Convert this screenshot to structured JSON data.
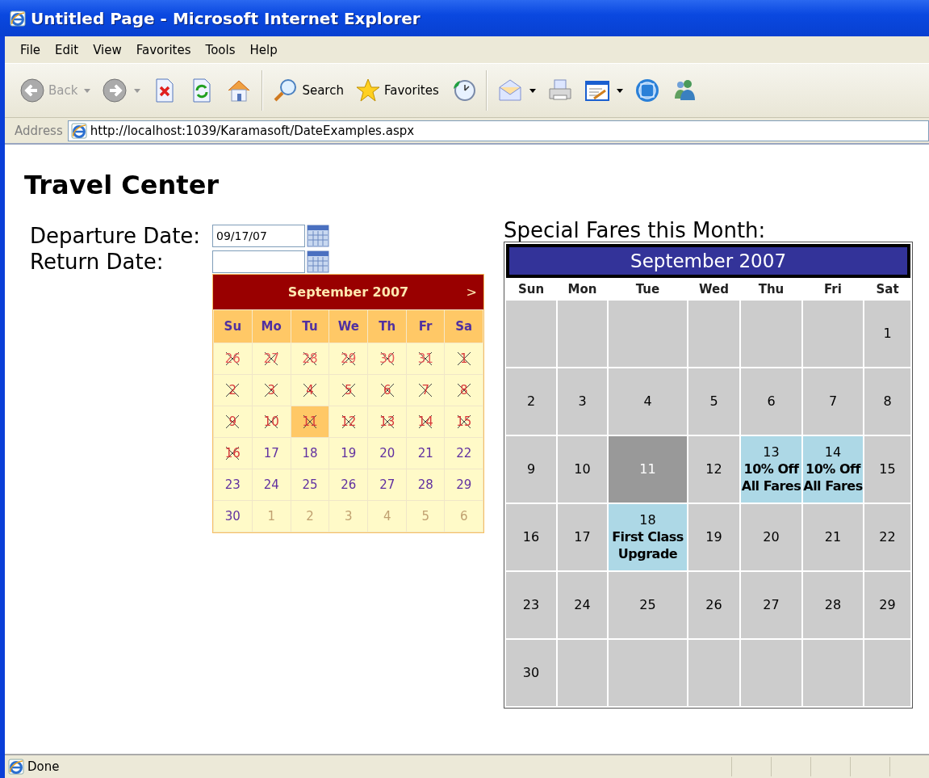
{
  "window": {
    "title": "Untitled Page - Microsoft Internet Explorer"
  },
  "menu": [
    {
      "label": "File"
    },
    {
      "label": "Edit"
    },
    {
      "label": "View"
    },
    {
      "label": "Favorites"
    },
    {
      "label": "Tools"
    },
    {
      "label": "Help"
    }
  ],
  "toolbar_groups": [
    [
      {
        "kind": "back",
        "label": "Back",
        "disabled": true,
        "dropdown": true
      },
      {
        "kind": "forward",
        "disabled": true,
        "dropdown": true
      },
      {
        "kind": "stop",
        "disabled": false,
        "dropdown": false
      },
      {
        "kind": "refresh",
        "disabled": false,
        "dropdown": false
      },
      {
        "kind": "home",
        "disabled": false,
        "dropdown": false
      }
    ],
    [
      {
        "kind": "search",
        "label": "Search",
        "disabled": false,
        "dropdown": false
      },
      {
        "kind": "favorites",
        "label": "Favorites",
        "disabled": false,
        "dropdown": false
      },
      {
        "kind": "history",
        "disabled": false,
        "dropdown": false
      }
    ],
    [
      {
        "kind": "mail",
        "disabled": false,
        "dropdown": true
      },
      {
        "kind": "print",
        "disabled": false,
        "dropdown": false
      },
      {
        "kind": "edit",
        "disabled": false,
        "dropdown": true
      },
      {
        "kind": "messenger",
        "disabled": false,
        "dropdown": false
      },
      {
        "kind": "people",
        "disabled": false,
        "dropdown": false
      }
    ]
  ],
  "address": {
    "label": "Address",
    "value": "http://localhost:1039/Karamasoft/DateExamples.aspx"
  },
  "page": {
    "heading": "Travel Center",
    "form": [
      {
        "label": "Departure Date:",
        "value": "09/17/07"
      },
      {
        "label": "Return Date:",
        "popup_open": true
      }
    ],
    "popup_calendar": {
      "title": "September 2007",
      "next": ">",
      "day_names": [
        "Su",
        "Mo",
        "Tu",
        "We",
        "Th",
        "Fr",
        "Sa"
      ],
      "weeks": [
        [
          {
            "day": "26",
            "disabled": true,
            "other_month": true,
            "selected": false
          },
          {
            "day": "27",
            "disabled": true,
            "other_month": true,
            "selected": false
          },
          {
            "day": "28",
            "disabled": true,
            "other_month": true,
            "selected": false
          },
          {
            "day": "29",
            "disabled": true,
            "other_month": true,
            "selected": false
          },
          {
            "day": "30",
            "disabled": true,
            "other_month": true,
            "selected": false
          },
          {
            "day": "31",
            "disabled": true,
            "other_month": true,
            "selected": false
          },
          {
            "day": "1",
            "disabled": true,
            "other_month": false,
            "selected": false
          }
        ],
        [
          {
            "day": "2",
            "disabled": true,
            "other_month": false,
            "selected": false
          },
          {
            "day": "3",
            "disabled": true,
            "other_month": false,
            "selected": false
          },
          {
            "day": "4",
            "disabled": true,
            "other_month": false,
            "selected": false
          },
          {
            "day": "5",
            "disabled": true,
            "other_month": false,
            "selected": false
          },
          {
            "day": "6",
            "disabled": true,
            "other_month": false,
            "selected": false
          },
          {
            "day": "7",
            "disabled": true,
            "other_month": false,
            "selected": false
          },
          {
            "day": "8",
            "disabled": true,
            "other_month": false,
            "selected": false
          }
        ],
        [
          {
            "day": "9",
            "disabled": true,
            "other_month": false,
            "selected": false
          },
          {
            "day": "10",
            "disabled": true,
            "other_month": false,
            "selected": false
          },
          {
            "day": "11",
            "disabled": true,
            "other_month": false,
            "selected": true
          },
          {
            "day": "12",
            "disabled": true,
            "other_month": false,
            "selected": false
          },
          {
            "day": "13",
            "disabled": true,
            "other_month": false,
            "selected": false
          },
          {
            "day": "14",
            "disabled": true,
            "other_month": false,
            "selected": false
          },
          {
            "day": "15",
            "disabled": true,
            "other_month": false,
            "selected": false
          }
        ],
        [
          {
            "day": "16",
            "disabled": true,
            "other_month": false,
            "selected": false
          },
          {
            "day": "17",
            "disabled": false,
            "other_month": false,
            "selected": false
          },
          {
            "day": "18",
            "disabled": false,
            "other_month": false,
            "selected": false
          },
          {
            "day": "19",
            "disabled": false,
            "other_month": false,
            "selected": false
          },
          {
            "day": "20",
            "disabled": false,
            "other_month": false,
            "selected": false
          },
          {
            "day": "21",
            "disabled": false,
            "other_month": false,
            "selected": false
          },
          {
            "day": "22",
            "disabled": false,
            "other_month": false,
            "selected": false
          }
        ],
        [
          {
            "day": "23",
            "disabled": false,
            "other_month": false,
            "selected": false
          },
          {
            "day": "24",
            "disabled": false,
            "other_month": false,
            "selected": false
          },
          {
            "day": "25",
            "disabled": false,
            "other_month": false,
            "selected": false
          },
          {
            "day": "26",
            "disabled": false,
            "other_month": false,
            "selected": false
          },
          {
            "day": "27",
            "disabled": false,
            "other_month": false,
            "selected": false
          },
          {
            "day": "28",
            "disabled": false,
            "other_month": false,
            "selected": false
          },
          {
            "day": "29",
            "disabled": false,
            "other_month": false,
            "selected": false
          }
        ],
        [
          {
            "day": "30",
            "disabled": false,
            "other_month": false,
            "selected": false
          },
          {
            "day": "1",
            "disabled": false,
            "other_month": true,
            "selected": false
          },
          {
            "day": "2",
            "disabled": false,
            "other_month": true,
            "selected": false
          },
          {
            "day": "3",
            "disabled": false,
            "other_month": true,
            "selected": false
          },
          {
            "day": "4",
            "disabled": false,
            "other_month": true,
            "selected": false
          },
          {
            "day": "5",
            "disabled": false,
            "other_month": true,
            "selected": false
          },
          {
            "day": "6",
            "disabled": false,
            "other_month": true,
            "selected": false
          }
        ]
      ]
    },
    "fares_calendar": {
      "label": "Special Fares this Month:",
      "title": "September 2007",
      "day_names": [
        "Sun",
        "Mon",
        "Tue",
        "Wed",
        "Thu",
        "Fri",
        "Sat"
      ],
      "weeks": [
        [
          {
            "kind": "blank"
          },
          {
            "kind": "blank"
          },
          {
            "kind": "blank"
          },
          {
            "kind": "blank"
          },
          {
            "kind": "blank"
          },
          {
            "kind": "blank"
          },
          {
            "kind": "day",
            "day": "1",
            "selected": false,
            "highlighted": false
          }
        ],
        [
          {
            "kind": "day",
            "day": "2",
            "selected": false,
            "highlighted": false
          },
          {
            "kind": "day",
            "day": "3",
            "selected": false,
            "highlighted": false
          },
          {
            "kind": "day",
            "day": "4",
            "selected": false,
            "highlighted": false
          },
          {
            "kind": "day",
            "day": "5",
            "selected": false,
            "highlighted": false
          },
          {
            "kind": "day",
            "day": "6",
            "selected": false,
            "highlighted": false
          },
          {
            "kind": "day",
            "day": "7",
            "selected": false,
            "highlighted": false
          },
          {
            "kind": "day",
            "day": "8",
            "selected": false,
            "highlighted": false
          }
        ],
        [
          {
            "kind": "day",
            "day": "9",
            "selected": false,
            "highlighted": false
          },
          {
            "kind": "day",
            "day": "10",
            "selected": false,
            "highlighted": false
          },
          {
            "kind": "day",
            "day": "11",
            "selected": true,
            "highlighted": false
          },
          {
            "kind": "day",
            "day": "12",
            "selected": false,
            "highlighted": false
          },
          {
            "kind": "day",
            "day": "13",
            "selected": false,
            "highlighted": true,
            "note": "10% Off All Fares"
          },
          {
            "kind": "day",
            "day": "14",
            "selected": false,
            "highlighted": true,
            "note": "10% Off All Fares"
          },
          {
            "kind": "day",
            "day": "15",
            "selected": false,
            "highlighted": false
          }
        ],
        [
          {
            "kind": "day",
            "day": "16",
            "selected": false,
            "highlighted": false
          },
          {
            "kind": "day",
            "day": "17",
            "selected": false,
            "highlighted": false
          },
          {
            "kind": "day",
            "day": "18",
            "selected": false,
            "highlighted": true,
            "note": "First Class Upgrade"
          },
          {
            "kind": "day",
            "day": "19",
            "selected": false,
            "highlighted": false
          },
          {
            "kind": "day",
            "day": "20",
            "selected": false,
            "highlighted": false
          },
          {
            "kind": "day",
            "day": "21",
            "selected": false,
            "highlighted": false
          },
          {
            "kind": "day",
            "day": "22",
            "selected": false,
            "highlighted": false
          }
        ],
        [
          {
            "kind": "day",
            "day": "23",
            "selected": false,
            "highlighted": false
          },
          {
            "kind": "day",
            "day": "24",
            "selected": false,
            "highlighted": false
          },
          {
            "kind": "day",
            "day": "25",
            "selected": false,
            "highlighted": false
          },
          {
            "kind": "day",
            "day": "26",
            "selected": false,
            "highlighted": false
          },
          {
            "kind": "day",
            "day": "27",
            "selected": false,
            "highlighted": false
          },
          {
            "kind": "day",
            "day": "28",
            "selected": false,
            "highlighted": false
          },
          {
            "kind": "day",
            "day": "29",
            "selected": false,
            "highlighted": false
          }
        ],
        [
          {
            "kind": "day",
            "day": "30",
            "selected": false,
            "highlighted": false
          },
          {
            "kind": "blank"
          },
          {
            "kind": "blank"
          },
          {
            "kind": "blank"
          },
          {
            "kind": "blank"
          },
          {
            "kind": "blank"
          },
          {
            "kind": "blank"
          }
        ]
      ]
    }
  },
  "status_bar": {
    "text": "Done"
  }
}
